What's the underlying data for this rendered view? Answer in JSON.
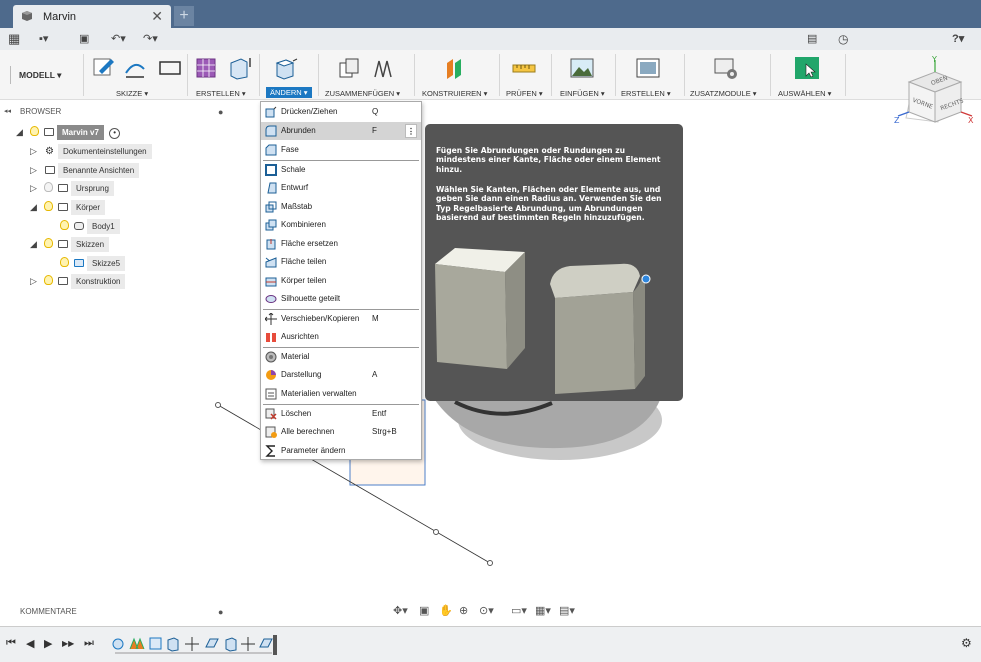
{
  "window": {
    "tab_title": "Marvin",
    "close_glyph": "✕",
    "new_tab_glyph": "+"
  },
  "quick_access": {
    "grid_glyph": "▦",
    "file_glyph": "▪▾",
    "save_glyph": "▣",
    "undo_glyph": "↶▾",
    "redo_glyph": "↷▾",
    "chat_glyph": "▤",
    "clock_glyph": "◷",
    "help_glyph": "?▾"
  },
  "ribbon": {
    "workspace": "MODELL ▾",
    "groups": [
      {
        "id": "skizze",
        "label": "SKIZZE ▾"
      },
      {
        "id": "erstellen1",
        "label": "ERSTELLEN ▾"
      },
      {
        "id": "aendern",
        "label": "ÄNDERN ▾"
      },
      {
        "id": "zusammenfuegen",
        "label": "ZUSAMMENFÜGEN ▾"
      },
      {
        "id": "konstruieren",
        "label": "KONSTRUIEREN ▾"
      },
      {
        "id": "pruefen",
        "label": "PRÜFEN ▾"
      },
      {
        "id": "einfuegen",
        "label": "EINFÜGEN ▾"
      },
      {
        "id": "erstellen2",
        "label": "ERSTELLEN ▾"
      },
      {
        "id": "zusatzmodule",
        "label": "ZUSATZMODULE ▾"
      },
      {
        "id": "auswaehlen",
        "label": "AUSWÄHLEN ▾"
      }
    ]
  },
  "viewcube": {
    "top": "OBEN",
    "front": "VORNE",
    "right": "RECHTS",
    "axis_x": "X",
    "axis_y": "Y",
    "axis_z": "Z"
  },
  "browser": {
    "title": "BROWSER",
    "collapse_glyph": "◂◂",
    "items": [
      {
        "label": "Marvin v7"
      },
      {
        "label": "Dokumenteinstellungen"
      },
      {
        "label": "Benannte Ansichten"
      },
      {
        "label": "Ursprung"
      },
      {
        "label": "Körper"
      },
      {
        "label": "Body1"
      },
      {
        "label": "Skizzen"
      },
      {
        "label": "Skizze5"
      },
      {
        "label": "Konstruktion"
      }
    ]
  },
  "menu": {
    "items": [
      {
        "label": "Drücken/Ziehen",
        "shortcut": "Q"
      },
      {
        "label": "Abrunden",
        "shortcut": "F"
      },
      {
        "label": "Fase",
        "shortcut": ""
      },
      {
        "label": "Schale",
        "shortcut": ""
      },
      {
        "label": "Entwurf",
        "shortcut": ""
      },
      {
        "label": "Maßstab",
        "shortcut": ""
      },
      {
        "label": "Kombinieren",
        "shortcut": ""
      },
      {
        "label": "Fläche ersetzen",
        "shortcut": ""
      },
      {
        "label": "Fläche teilen",
        "shortcut": ""
      },
      {
        "label": "Körper teilen",
        "shortcut": ""
      },
      {
        "label": "Silhouette geteilt",
        "shortcut": ""
      },
      {
        "label": "Verschieben/Kopieren",
        "shortcut": "M"
      },
      {
        "label": "Ausrichten",
        "shortcut": ""
      },
      {
        "label": "Material",
        "shortcut": ""
      },
      {
        "label": "Darstellung",
        "shortcut": "A"
      },
      {
        "label": "Materialien verwalten",
        "shortcut": ""
      },
      {
        "label": "Löschen",
        "shortcut": "Entf"
      },
      {
        "label": "Alle berechnen",
        "shortcut": "Strg+B"
      },
      {
        "label": "Parameter ändern",
        "shortcut": ""
      }
    ],
    "more_glyph": "⋮"
  },
  "tooltip": {
    "p1": "Fügen Sie Abrundungen oder Rundungen zu mindestens einer Kante, Fläche oder einem Element hinzu.",
    "p2": "Wählen Sie Kanten, Flächen oder Elemente aus, und geben Sie dann einen Radius an. Verwenden Sie den Typ Regelbasierte Abrundung, um Abrundungen basierend auf bestimmten Regeln hinzuzufügen."
  },
  "comments": {
    "title": "KOMMENTARE"
  },
  "navbar": {
    "glyphs": [
      "✥▾",
      "▣",
      "✋",
      "⊕",
      "⊙▾",
      "▭▾",
      "▦▾",
      "▤▾"
    ]
  },
  "timeline": {
    "first": "⏮",
    "prev": "◀",
    "play": "▶",
    "next": "▶▶",
    "last": "⏭",
    "settings_glyph": "⚙"
  }
}
